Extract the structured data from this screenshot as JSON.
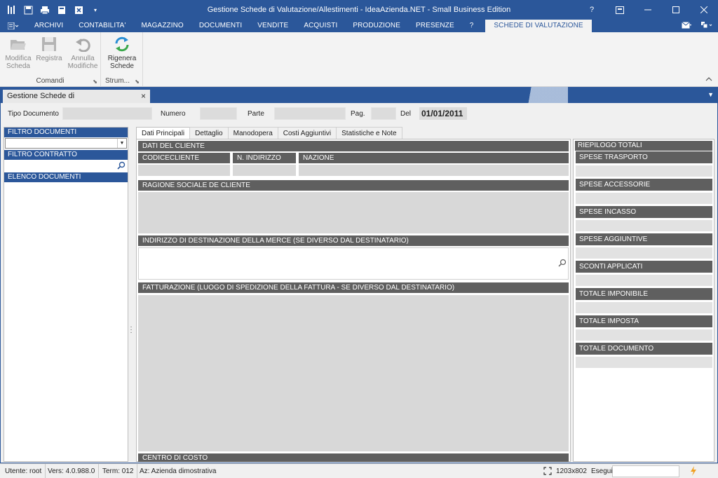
{
  "window": {
    "title": "Gestione Schede di Valutazione/Allestimenti - IdeaAzienda.NET - Small Business Edition",
    "help": "?"
  },
  "menu": {
    "tabs": [
      "ARCHIVI",
      "CONTABILITA'",
      "MAGAZZINO",
      "DOCUMENTI",
      "VENDITE",
      "ACQUISTI",
      "PRODUZIONE",
      "PRESENZE",
      "?"
    ],
    "active_tab": "SCHEDE DI VALUTAZIONE"
  },
  "ribbon": {
    "groups": [
      {
        "label": "Comandi",
        "buttons": [
          {
            "label1": "Modifica",
            "label2": "Scheda"
          },
          {
            "label1": "Registra",
            "label2": ""
          },
          {
            "label1": "Annulla",
            "label2": "Modifiche"
          }
        ]
      },
      {
        "label": "Strum...",
        "buttons": [
          {
            "label1": "Rigenera",
            "label2": "Schede"
          }
        ]
      }
    ]
  },
  "doc_tab": {
    "label": "Gestione Schede di Valutazione/Allestimenti",
    "close": "×"
  },
  "header": {
    "tipo_documento_label": "Tipo Documento",
    "numero_label": "Numero",
    "parte_label": "Parte",
    "pag_label": "Pag.",
    "del_label": "Del",
    "del_value": "01/01/2011"
  },
  "left": {
    "filtro_documenti": "FILTRO DOCUMENTI",
    "filtro_contratto": "FILTRO CONTRATTO",
    "elenco_documenti": "ELENCO DOCUMENTI"
  },
  "tabs": [
    "Dati Principali",
    "Dettaglio",
    "Manodopera",
    "Costi Aggiuntivi",
    "Statistiche e Note"
  ],
  "main": {
    "dati_cliente": "DATI DEL CLIENTE",
    "codicecliente": "CODICECLIENTE",
    "n_indirizzo": "N. INDIRIZZO",
    "nazione": "NAZIONE",
    "ragione_sociale": "RAGIONE SOCIALE DE CLIENTE",
    "indirizzo_dest": "INDIRIZZO DI DESTINAZIONE DELLA MERCE (SE DIVERSO DAL DESTINATARIO)",
    "fatturazione": "FATTURAZIONE (LUOGO DI SPEDIZIONE DELLA FATTURA - SE DIVERSO DAL DESTINATARIO)",
    "centro_costo": "CENTRO DI COSTO"
  },
  "totals": {
    "title": "RIEPILOGO TOTALI",
    "items": [
      "SPESE TRASPORTO",
      "SPESE ACCESSORIE",
      "SPESE INCASSO",
      "SPESE AGGIUNTIVE",
      "SCONTI APPLICATI",
      "TOTALE IMPONIBILE",
      "TOTALE IMPOSTA",
      "TOTALE DOCUMENTO"
    ]
  },
  "status": {
    "utente": "Utente: root",
    "vers": "Vers: 4.0.988.0",
    "term": "Term: 012",
    "az": "Az: Azienda dimostrativa",
    "resolution": "1203x802",
    "esegui": "Esegui"
  },
  "colors": {
    "accent": "#2b579a",
    "section": "#5f5f5f",
    "field": "#d8d8d8"
  }
}
